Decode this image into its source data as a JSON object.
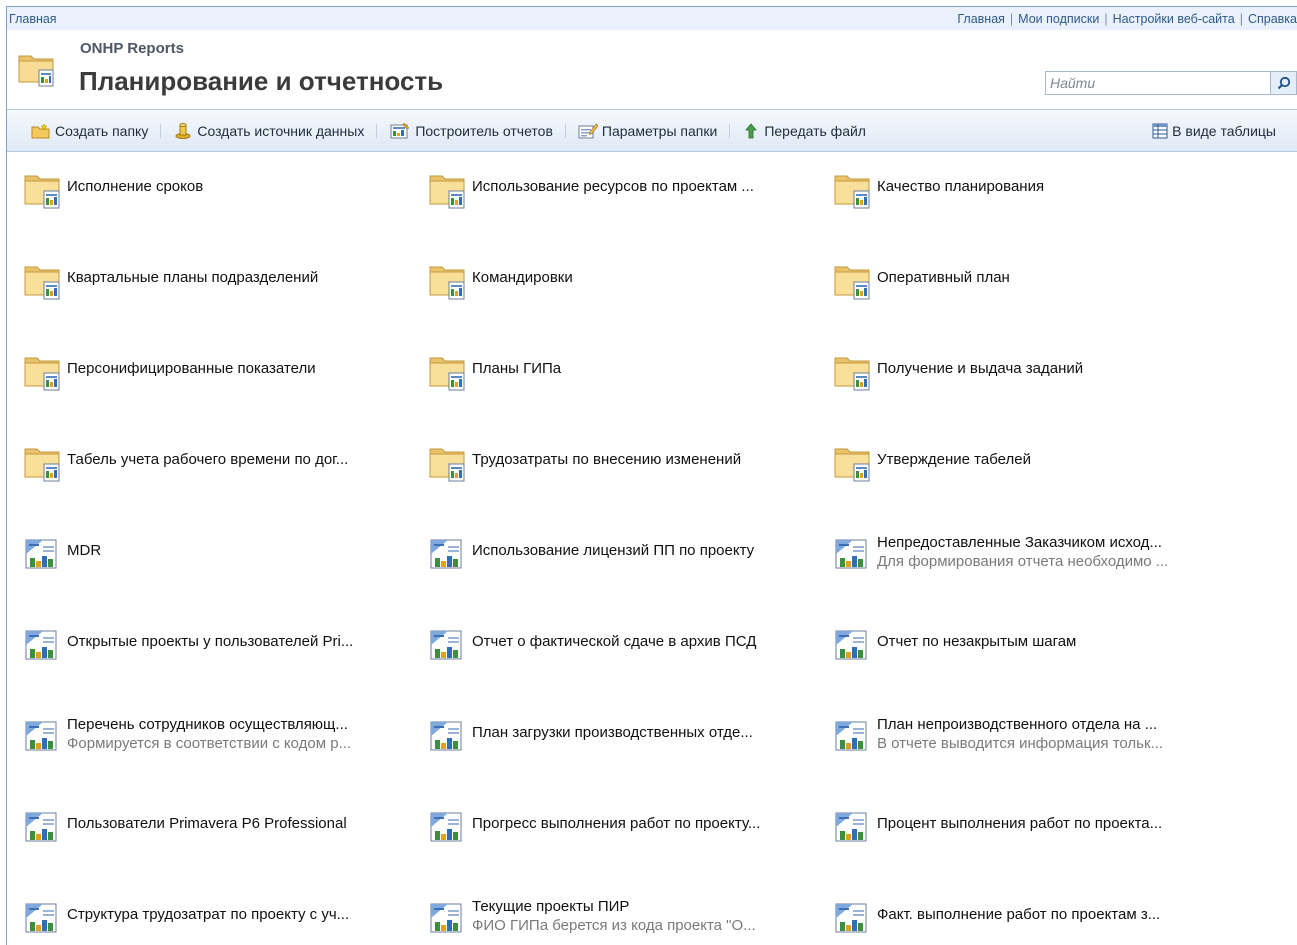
{
  "topbar": {
    "home_left": "Главная",
    "links": [
      "Главная",
      "Мои подписки",
      "Настройки веб-сайта",
      "Справка"
    ]
  },
  "header": {
    "site_name": "ONHP Reports",
    "page_title": "Планирование и отчетность",
    "search_placeholder": "Найти"
  },
  "toolbar": {
    "new_folder": "Создать папку",
    "new_datasource": "Создать источник данных",
    "report_builder": "Построитель отчетов",
    "folder_settings": "Параметры папки",
    "upload_file": "Передать файл",
    "details_view": "В виде таблицы"
  },
  "items": [
    {
      "type": "folder",
      "name": "Исполнение сроков",
      "desc": ""
    },
    {
      "type": "folder",
      "name": "Использование ресурсов по проектам ...",
      "desc": ""
    },
    {
      "type": "folder",
      "name": "Качество планирования",
      "desc": ""
    },
    {
      "type": "folder",
      "name": "Квартальные планы подразделений",
      "desc": ""
    },
    {
      "type": "folder",
      "name": "Командировки",
      "desc": ""
    },
    {
      "type": "folder",
      "name": "Оперативный план",
      "desc": ""
    },
    {
      "type": "folder",
      "name": "Персонифицированные показатели",
      "desc": ""
    },
    {
      "type": "folder",
      "name": "Планы ГИПа",
      "desc": ""
    },
    {
      "type": "folder",
      "name": "Получение и выдача заданий",
      "desc": ""
    },
    {
      "type": "folder",
      "name": "Табель учета рабочего времени по дог...",
      "desc": ""
    },
    {
      "type": "folder",
      "name": "Трудозатраты по внесению изменений",
      "desc": ""
    },
    {
      "type": "folder",
      "name": "Утверждение табелей",
      "desc": ""
    },
    {
      "type": "report",
      "name": "MDR",
      "desc": ""
    },
    {
      "type": "report",
      "name": "Использование лицензий ПП по проекту",
      "desc": ""
    },
    {
      "type": "report",
      "name": "Непредоставленные Заказчиком исход...",
      "desc": "Для формирования отчета необходимо ..."
    },
    {
      "type": "report",
      "name": "Открытые проекты у пользователей Pri...",
      "desc": ""
    },
    {
      "type": "report",
      "name": "Отчет о фактической сдаче в архив ПСД",
      "desc": ""
    },
    {
      "type": "report",
      "name": "Отчет по незакрытым шагам",
      "desc": ""
    },
    {
      "type": "report",
      "name": "Перечень сотрудников осуществляющ...",
      "desc": "Формируется в соответствии с кодом р..."
    },
    {
      "type": "report",
      "name": "План загрузки производственных отде...",
      "desc": ""
    },
    {
      "type": "report",
      "name": "План непроизводственного отдела на ...",
      "desc": "В отчете выводится информация тольк..."
    },
    {
      "type": "report",
      "name": "Пользователи Primavera P6 Professional",
      "desc": ""
    },
    {
      "type": "report",
      "name": "Прогресс выполнения работ по проекту...",
      "desc": ""
    },
    {
      "type": "report",
      "name": "Процент выполнения работ по проекта...",
      "desc": ""
    },
    {
      "type": "report",
      "name": "Структура трудозатрат по проекту с уч...",
      "desc": ""
    },
    {
      "type": "report",
      "name": "Текущие проекты ПИР",
      "desc": "ФИО ГИПа берется из кода проекта \"О..."
    },
    {
      "type": "report",
      "name": "Факт. выполнение работ по проектам з...",
      "desc": ""
    }
  ]
}
